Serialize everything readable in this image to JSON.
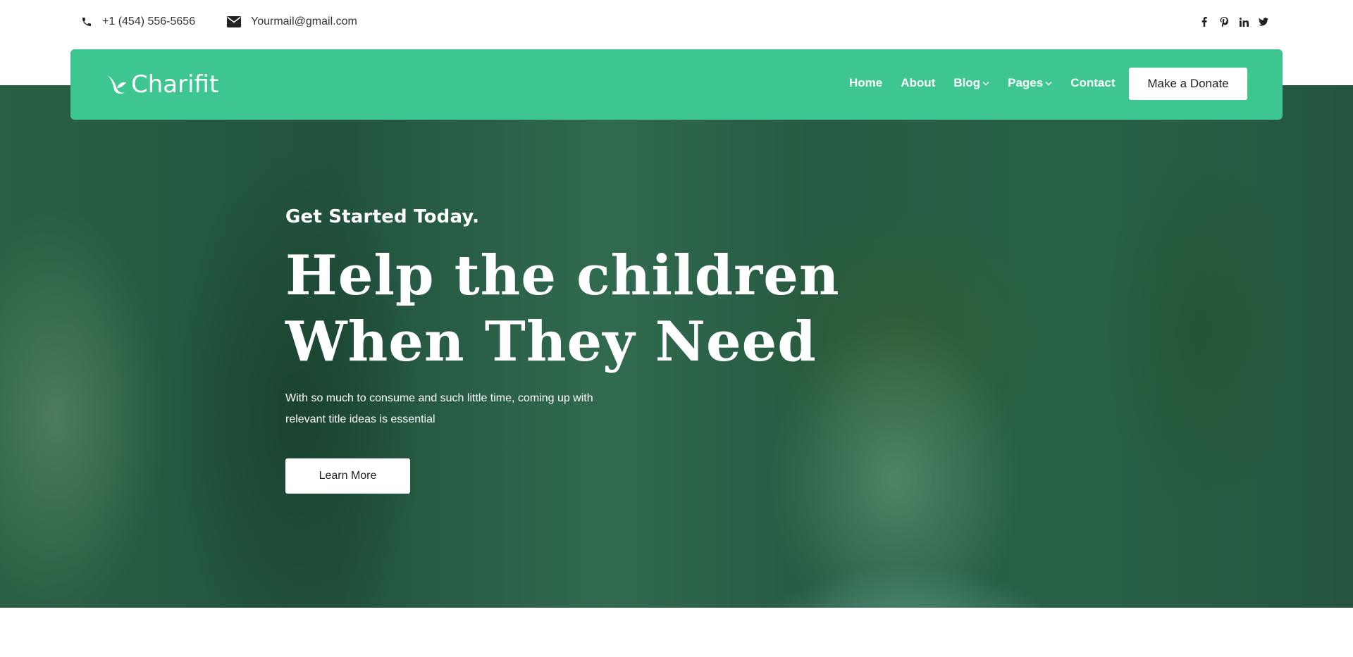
{
  "topbar": {
    "phone": "+1 (454) 556-5656",
    "email": "Yourmail@gmail.com",
    "social": [
      "facebook-icon",
      "pinterest-icon",
      "linkedin-icon",
      "twitter-icon"
    ]
  },
  "nav": {
    "brand": "Charifit",
    "items": [
      {
        "label": "Home",
        "dropdown": false
      },
      {
        "label": "About",
        "dropdown": false
      },
      {
        "label": "Blog",
        "dropdown": true
      },
      {
        "label": "Pages",
        "dropdown": true
      },
      {
        "label": "Contact",
        "dropdown": false
      }
    ],
    "cta": "Make a Donate"
  },
  "hero": {
    "eyebrow": "Get Started Today.",
    "headline_line1": "Help the children",
    "headline_line2": "When They Need",
    "description": "With so much to consume and such little time, coming up with relevant title ideas is essential",
    "button": "Learn More"
  },
  "colors": {
    "brand": "#3dc68f",
    "overlay": "#1e6e46",
    "text_dark": "#222222",
    "white": "#ffffff"
  }
}
